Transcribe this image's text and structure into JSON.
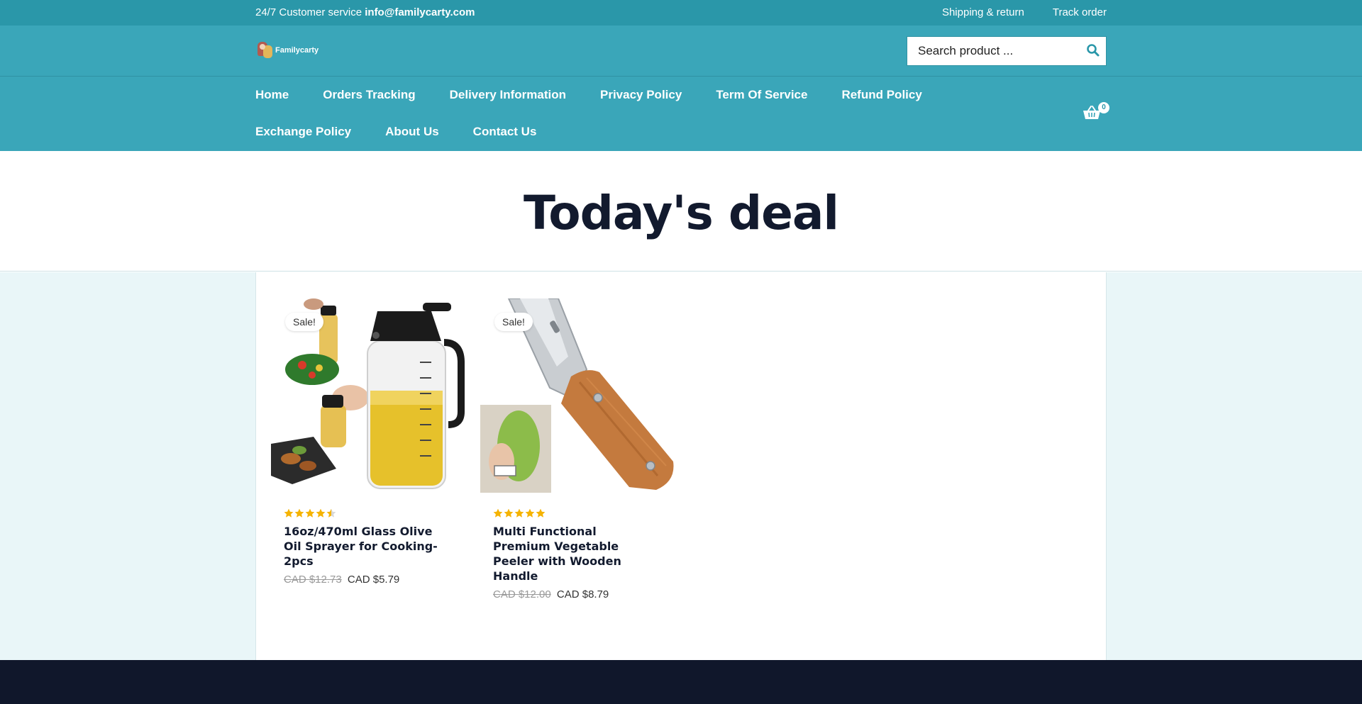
{
  "topbar": {
    "service_label": "24/7 Customer service",
    "email": "info@familycarty.com",
    "links": [
      "Shipping & return",
      "Track order"
    ]
  },
  "header": {
    "logo_text": "Familycarty",
    "search_placeholder": "Search product ..."
  },
  "nav": {
    "items": [
      "Home",
      "Orders Tracking",
      "Delivery Information",
      "Privacy Policy",
      "Term Of Service",
      "Refund Policy",
      "Exchange Policy",
      "About Us",
      "Contact Us"
    ],
    "cart_count": "0"
  },
  "hero": {
    "title": "Today's deal"
  },
  "products": [
    {
      "badge": "Sale!",
      "rating": 4.5,
      "title": "16oz/470ml Glass Olive Oil Sprayer for Cooking- 2pcs",
      "old_price": "CAD $12.73",
      "price": "CAD $5.79"
    },
    {
      "badge": "Sale!",
      "rating": 5,
      "title": "Multi Functional Premium Vegetable Peeler with Wooden Handle",
      "old_price": "CAD $12.00",
      "price": "CAD $8.79"
    }
  ],
  "colors": {
    "topbar": "#2a97a9",
    "header": "#3aa6b9",
    "content_bg": "#e9f6f8",
    "footer": "#10172b",
    "star": "#f5b301"
  }
}
